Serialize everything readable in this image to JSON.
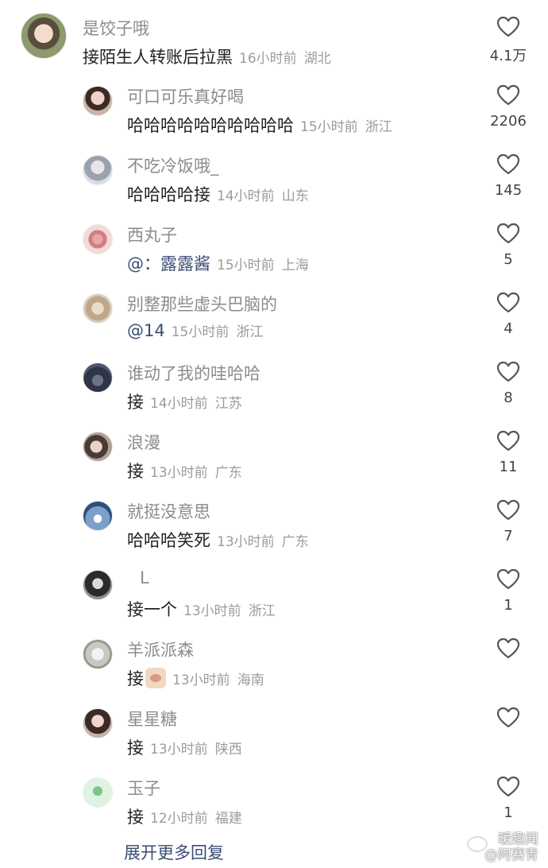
{
  "comments": [
    {
      "username": "是饺子哦",
      "content": "接陌生人转账后拉黑",
      "time": "16小时前",
      "location": "湖北",
      "likes": "4.1万"
    },
    {
      "username": "可口可乐真好喝",
      "content": "哈哈哈哈哈哈哈哈哈哈",
      "time": "15小时前",
      "location": "浙江",
      "likes": "2206"
    },
    {
      "username": "不吃冷饭哦_",
      "content": "哈哈哈哈接",
      "time": "14小时前",
      "location": "山东",
      "likes": "145"
    },
    {
      "username": "西丸子",
      "content": "@：露露酱",
      "time": "15小时前",
      "location": "上海",
      "likes": "5"
    },
    {
      "username": "别整那些虚头巴脑的",
      "content": "@14",
      "time": "15小时前",
      "location": "浙江",
      "likes": "4"
    },
    {
      "username": "谁动了我的哇哈哈",
      "content": "接",
      "time": "14小时前",
      "location": "江苏",
      "likes": "8"
    },
    {
      "username": "浪漫",
      "content": "接",
      "time": "13小时前",
      "location": "广东",
      "likes": "11"
    },
    {
      "username": "就挺没意思",
      "content": "哈哈哈笑死",
      "time": "13小时前",
      "location": "广东",
      "likes": "7"
    },
    {
      "username": "L",
      "content": "接一个",
      "time": "13小时前",
      "location": "浙江",
      "likes": "1"
    },
    {
      "username": "羊派派森",
      "content": "接",
      "time": "13小时前",
      "location": "海南",
      "likes": ""
    },
    {
      "username": "星星糖",
      "content": "接",
      "time": "13小时前",
      "location": "陕西",
      "likes": ""
    },
    {
      "username": "玉子",
      "content": "接",
      "time": "12小时前",
      "location": "福建",
      "likes": "1"
    }
  ],
  "expand_label": "展开更多回复",
  "watermark": {
    "line1": "暖趣闻",
    "line2": "@阿赛青"
  },
  "colors": {
    "mention": "#3a4d72",
    "username": "#8c8c8c",
    "meta": "#9b9b9b"
  },
  "icons": {
    "like": "heart-outline-icon",
    "sticker": "emoji-sticker-icon"
  }
}
